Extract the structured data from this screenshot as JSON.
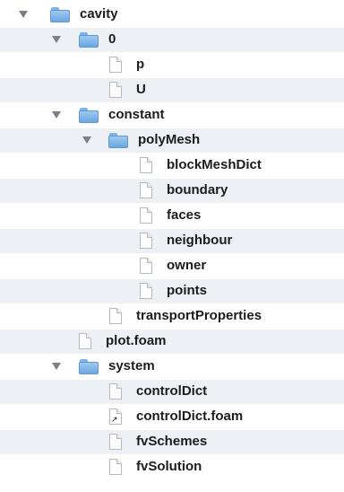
{
  "tree": {
    "rows": [
      {
        "label": "cavity",
        "type": "folder",
        "expanded": true
      },
      {
        "label": "0",
        "type": "folder",
        "expanded": true
      },
      {
        "label": "p",
        "type": "file"
      },
      {
        "label": "U",
        "type": "file"
      },
      {
        "label": "constant",
        "type": "folder",
        "expanded": true
      },
      {
        "label": "polyMesh",
        "type": "folder",
        "expanded": true
      },
      {
        "label": "blockMeshDict",
        "type": "file"
      },
      {
        "label": "boundary",
        "type": "file"
      },
      {
        "label": "faces",
        "type": "file"
      },
      {
        "label": "neighbour",
        "type": "file"
      },
      {
        "label": "owner",
        "type": "file"
      },
      {
        "label": "points",
        "type": "file"
      },
      {
        "label": "transportProperties",
        "type": "file"
      },
      {
        "label": "plot.foam",
        "type": "file"
      },
      {
        "label": "system",
        "type": "folder",
        "expanded": true
      },
      {
        "label": "controlDict",
        "type": "file"
      },
      {
        "label": "controlDict.foam",
        "type": "file-alias"
      },
      {
        "label": "fvSchemes",
        "type": "file"
      },
      {
        "label": "fvSolution",
        "type": "file"
      }
    ]
  },
  "colors": {
    "stripe": "#edf1f6",
    "folder": "#7fb4e8",
    "disclosure": "#7a7f86"
  }
}
